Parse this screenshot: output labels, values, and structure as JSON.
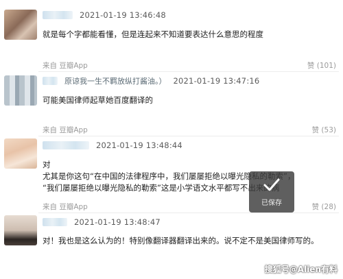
{
  "comments": [
    {
      "time": "2021-01-19 13:46:48",
      "nickname": "",
      "text": [
        "就是每个字都能看懂，但是连起来不知道要表达什么意思的程度"
      ],
      "source": "来自 豆瓣App",
      "likes": "赞 (101)"
    },
    {
      "time": "2021-01-19 13:47:16",
      "nickname": "原谅我一生不羁放纵打酱油。）",
      "text": [
        "可能美国律师起草她百度翻译的"
      ],
      "source": "来自 豆瓣App",
      "likes": "赞 (53)"
    },
    {
      "time": "2021-01-19 13:48:44",
      "nickname": "",
      "text": [
        "对",
        "尤其是你这句“在中国的法律程序中，我们屡屡拒绝以曝光隐私的勒索”，",
        "“我们屡屡拒绝以曝光隐私的勒索”这是小学语文水平都写不出来的病"
      ],
      "source": "来自 豆瓣App",
      "likes": "赞 (28)"
    },
    {
      "time": "2021-01-19 13:48:47",
      "nickname": "",
      "text": [
        "对！我也是这么认为的！特别像翻译器翻译出来的。说不定不是美国律师写的。"
      ],
      "source": "",
      "likes": ""
    }
  ],
  "toast": {
    "label": "已保存",
    "icon": "check-icon"
  },
  "watermark": "搜狐号@Alien有料",
  "colors": {
    "toast_bg": "#3c3c3c",
    "time": "#5a5a5a",
    "meta": "#9a9a9a"
  }
}
